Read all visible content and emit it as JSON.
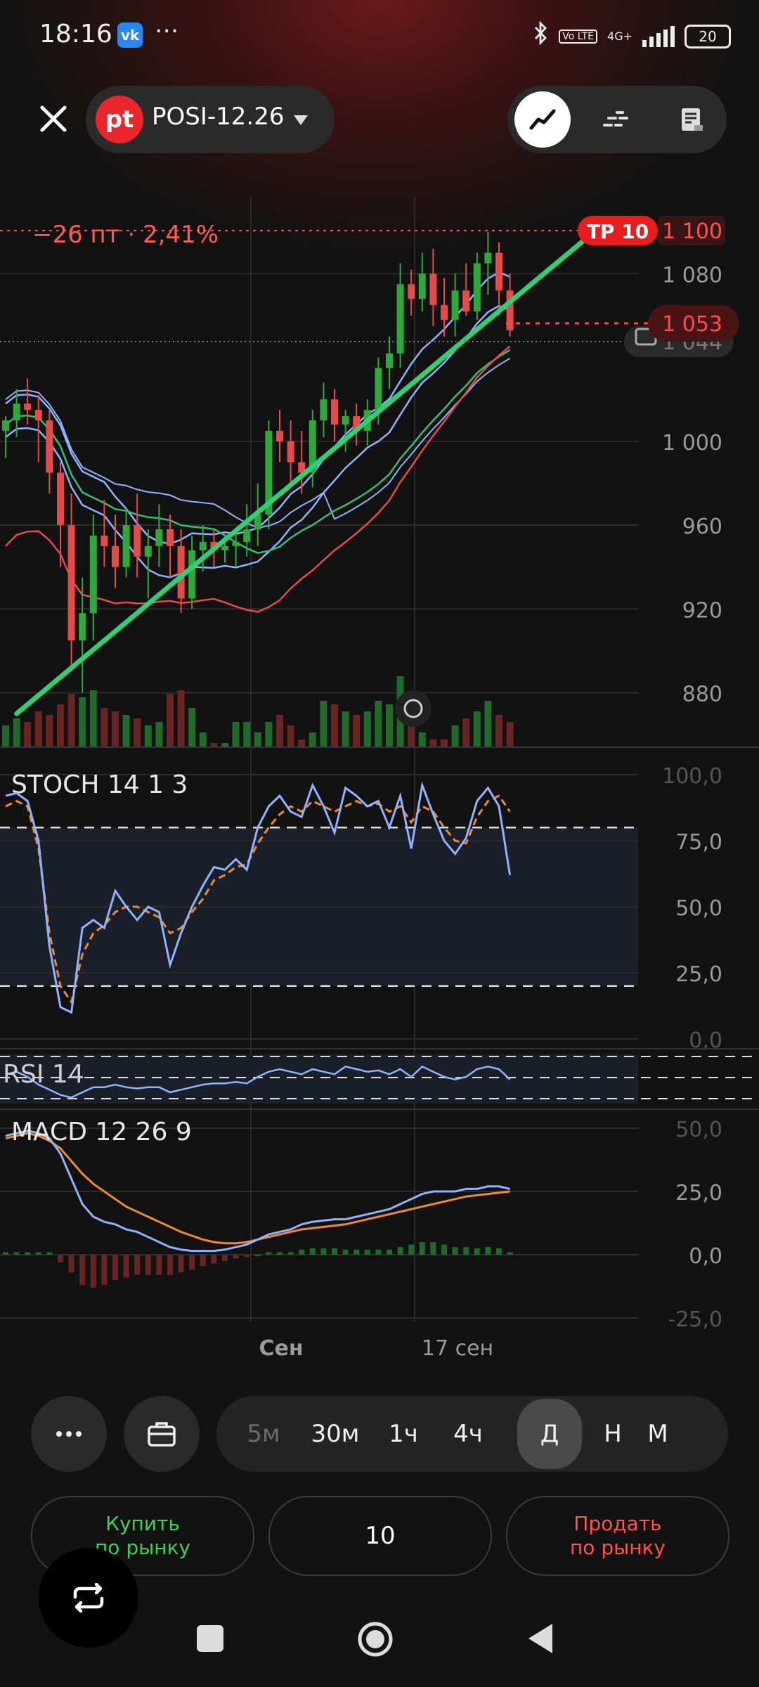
{
  "status_bar": {
    "time": "18:16",
    "vk_badge": "vk",
    "more": "···",
    "volte": "Vo LTE",
    "network": "4G+",
    "battery": "20"
  },
  "header": {
    "logo": "pt",
    "ticker": "POSI-12.26",
    "icons": [
      "close-icon",
      "dropdown-caret-icon",
      "line-chart-icon",
      "dashed-lines-icon",
      "news-icon"
    ]
  },
  "chart_data": {
    "type": "candlestick",
    "title": "",
    "price_change_label": "−26 пт · 2,41%",
    "take_profit_label": "TP 10",
    "take_profit_price": "1 100",
    "current_price": "1 053",
    "hidden_price_partial": "1 044",
    "y_ticks": [
      "1 080",
      "1 000",
      "960",
      "920",
      "880"
    ],
    "y_tick_values": [
      1080,
      1000,
      960,
      920,
      880
    ],
    "x_labels": [
      "Сен",
      "17 сен"
    ],
    "ylim": [
      855,
      1110
    ],
    "candles": [
      [
        1005,
        1012,
        992,
        1010
      ],
      [
        1010,
        1025,
        1002,
        1018
      ],
      [
        1018,
        1030,
        1008,
        1015
      ],
      [
        1015,
        1022,
        990,
        1010
      ],
      [
        1010,
        1015,
        975,
        985
      ],
      [
        985,
        990,
        940,
        960
      ],
      [
        960,
        975,
        890,
        905
      ],
      [
        905,
        935,
        880,
        918
      ],
      [
        918,
        965,
        905,
        955
      ],
      [
        955,
        972,
        940,
        950
      ],
      [
        950,
        965,
        930,
        940
      ],
      [
        940,
        968,
        935,
        960
      ],
      [
        960,
        975,
        935,
        945
      ],
      [
        945,
        958,
        925,
        950
      ],
      [
        950,
        970,
        940,
        958
      ],
      [
        958,
        965,
        935,
        950
      ],
      [
        950,
        958,
        918,
        925
      ],
      [
        925,
        955,
        920,
        948
      ],
      [
        948,
        960,
        938,
        952
      ],
      [
        952,
        958,
        940,
        948
      ],
      [
        948,
        955,
        942,
        950
      ],
      [
        950,
        958,
        940,
        952
      ],
      [
        952,
        970,
        945,
        958
      ],
      [
        958,
        980,
        950,
        965
      ],
      [
        965,
        1010,
        958,
        1005
      ],
      [
        1005,
        1015,
        990,
        1000
      ],
      [
        1000,
        1010,
        980,
        990
      ],
      [
        990,
        1005,
        975,
        985
      ],
      [
        985,
        1015,
        978,
        1010
      ],
      [
        1010,
        1028,
        1002,
        1020
      ],
      [
        1020,
        1025,
        1000,
        1008
      ],
      [
        1008,
        1015,
        995,
        1012
      ],
      [
        1012,
        1018,
        998,
        1005
      ],
      [
        1005,
        1020,
        998,
        1015
      ],
      [
        1015,
        1040,
        1008,
        1035
      ],
      [
        1035,
        1050,
        1025,
        1042
      ],
      [
        1042,
        1085,
        1035,
        1075
      ],
      [
        1075,
        1082,
        1060,
        1068
      ],
      [
        1068,
        1090,
        1062,
        1080
      ],
      [
        1080,
        1092,
        1055,
        1065
      ],
      [
        1065,
        1078,
        1050,
        1058
      ],
      [
        1058,
        1080,
        1050,
        1072
      ],
      [
        1072,
        1085,
        1060,
        1062
      ],
      [
        1062,
        1090,
        1058,
        1085
      ],
      [
        1085,
        1100,
        1070,
        1090
      ],
      [
        1090,
        1095,
        1060,
        1072
      ],
      [
        1072,
        1080,
        1050,
        1053
      ]
    ],
    "volume": [
      0.3,
      0.4,
      0.35,
      0.5,
      0.45,
      0.6,
      0.75,
      0.7,
      0.8,
      0.55,
      0.5,
      0.45,
      0.4,
      0.3,
      0.35,
      0.75,
      0.8,
      0.55,
      0.2,
      0.05,
      0.05,
      0.35,
      0.35,
      0.2,
      0.35,
      0.45,
      0.3,
      0.1,
      0.2,
      0.65,
      0.6,
      0.5,
      0.45,
      0.5,
      0.65,
      0.6,
      1.0,
      0.3,
      0.2,
      0.1,
      0.1,
      0.3,
      0.4,
      0.5,
      0.65,
      0.45,
      0.35
    ],
    "trendline": [
      [
        1,
        870
      ],
      [
        46,
        1105
      ]
    ],
    "stoch": {
      "label": "STOCH 14 1 3",
      "ticks": [
        "100,0",
        "75,0",
        "50,0",
        "25,0",
        "0,0"
      ],
      "k": [
        92,
        93,
        90,
        75,
        35,
        12,
        10,
        42,
        45,
        42,
        56,
        50,
        45,
        50,
        48,
        28,
        40,
        50,
        58,
        65,
        64,
        68,
        64,
        80,
        88,
        92,
        86,
        84,
        96,
        88,
        78,
        95,
        92,
        88,
        90,
        80,
        92,
        72,
        96,
        85,
        75,
        70,
        76,
        90,
        95,
        88,
        62
      ],
      "d": [
        88,
        90,
        88,
        72,
        40,
        20,
        14,
        32,
        40,
        43,
        48,
        50,
        50,
        48,
        46,
        40,
        42,
        48,
        53,
        60,
        62,
        65,
        66,
        74,
        80,
        85,
        88,
        86,
        90,
        88,
        86,
        88,
        90,
        88,
        89,
        86,
        88,
        82,
        88,
        86,
        80,
        75,
        74,
        84,
        90,
        92,
        86
      ]
    },
    "rsi": {
      "label": "RSI 14",
      "values": [
        60,
        62,
        58,
        52,
        48,
        44,
        42,
        46,
        50,
        50,
        52,
        50,
        49,
        50,
        50,
        46,
        48,
        50,
        52,
        53,
        53,
        54,
        53,
        58,
        62,
        64,
        62,
        60,
        64,
        62,
        60,
        66,
        64,
        62,
        63,
        60,
        64,
        58,
        66,
        62,
        58,
        56,
        58,
        64,
        66,
        64,
        56
      ]
    },
    "macd": {
      "label": "MACD 12 26 9",
      "ticks": [
        "50,0",
        "25,0",
        "0,0",
        "-25,0"
      ],
      "macd": [
        47,
        48,
        49,
        48,
        46,
        40,
        30,
        20,
        15,
        13,
        12,
        10,
        9,
        7,
        5,
        3,
        2,
        1.5,
        1.5,
        1.5,
        2,
        3,
        4,
        6,
        8,
        9,
        10,
        12,
        13,
        13.5,
        14,
        14,
        15,
        16,
        17,
        18,
        20,
        22,
        24,
        25,
        25,
        25,
        26,
        26,
        27,
        27,
        26
      ],
      "signal": [
        46,
        47,
        48,
        47,
        45,
        42,
        37,
        32,
        28,
        25,
        22,
        19,
        17,
        15,
        13,
        11,
        9,
        7.5,
        6,
        5,
        4.5,
        4.5,
        5,
        6,
        7,
        8,
        9,
        10,
        10.5,
        11,
        11.5,
        12,
        13,
        14,
        15,
        16,
        17,
        18,
        19,
        20,
        21,
        22,
        23,
        23.5,
        24,
        24.5,
        25
      ],
      "hist": [
        1,
        1,
        1,
        1,
        1,
        -3,
        -7,
        -12,
        -13,
        -12,
        -10,
        -9,
        -8,
        -8,
        -8,
        -8,
        -7,
        -6,
        -4.5,
        -3.5,
        -2.5,
        -1.5,
        -1,
        0,
        1,
        1,
        1,
        2,
        2.5,
        2.5,
        2.5,
        2,
        2,
        2,
        2,
        2,
        3,
        4,
        5,
        5,
        4,
        3,
        3,
        2.5,
        3,
        2.5,
        1
      ]
    }
  },
  "toolbar": {
    "more_icon": "more-horizontal-icon",
    "portfolio_icon": "briefcase-icon",
    "periods": [
      "5м",
      "30м",
      "1ч",
      "4ч",
      "Д",
      "Н",
      "М"
    ],
    "selected_period": "Д"
  },
  "trade": {
    "buy_line1": "Купить",
    "buy_line2": "по рынку",
    "quantity": "10",
    "sell_line1": "Продать",
    "sell_line2": "по рынку"
  },
  "colors": {
    "bull": "#2eaa3c",
    "bear": "#e84a4a",
    "trend": "#2fcf75",
    "accent_red": "#ff3b30",
    "stoch_k": "#8fb3ff",
    "stoch_d": "#f08c28",
    "macd_line": "#8fb3ff",
    "signal_line": "#f08c28"
  }
}
